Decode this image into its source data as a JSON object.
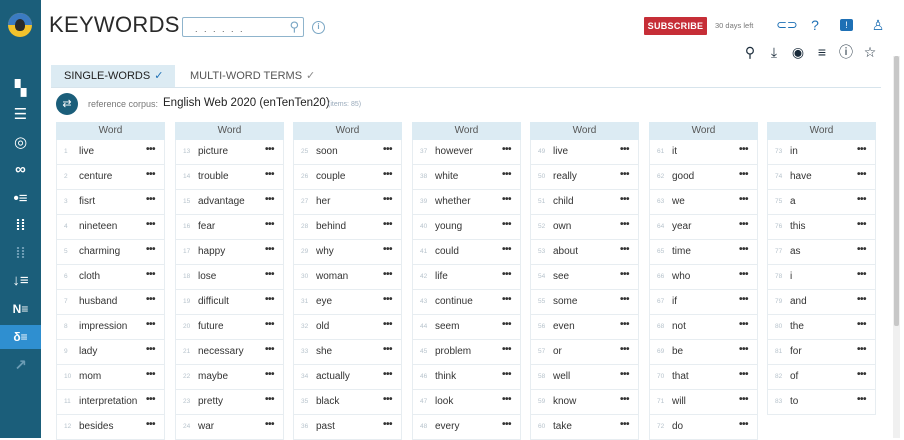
{
  "app": {
    "title": "KEYWORDS"
  },
  "search": {
    "placeholder": ""
  },
  "header": {
    "subscribe_label": "SUBSCRIBE",
    "days_left": "30 days left",
    "brand_color": "#1b5e7a",
    "accent_color": "#1e70b5",
    "subscribe_color": "#c62e37"
  },
  "sidebar": {
    "icons": [
      "logo-icon",
      "dashboard-icon",
      "list-icon",
      "target-icon",
      "infinity-icon",
      "bullet-list-icon",
      "grid-icon",
      "dotted-grid-icon",
      "sort-icon",
      "ne-icon",
      "delta-list-icon",
      "trend-icon"
    ]
  },
  "tabs": [
    {
      "label": "SINGLE-WORDS",
      "check": "✓",
      "active": true
    },
    {
      "label": "MULTI-WORD TERMS",
      "check": "✓",
      "active": false
    }
  ],
  "corpus": {
    "label": "reference corpus:",
    "value": "English Web 2020 (enTenTen20)",
    "items": "(items: 85)"
  },
  "table": {
    "column_header": "Word",
    "more_label": "•••",
    "columns": [
      [
        {
          "n": "1",
          "w": "live"
        },
        {
          "n": "2",
          "w": "centure"
        },
        {
          "n": "3",
          "w": "fisrt"
        },
        {
          "n": "4",
          "w": "nineteen"
        },
        {
          "n": "5",
          "w": "charming"
        },
        {
          "n": "6",
          "w": "cloth"
        },
        {
          "n": "7",
          "w": "husband"
        },
        {
          "n": "8",
          "w": "impression"
        },
        {
          "n": "9",
          "w": "lady"
        },
        {
          "n": "10",
          "w": "mom"
        },
        {
          "n": "11",
          "w": "interpretation"
        },
        {
          "n": "12",
          "w": "besides"
        }
      ],
      [
        {
          "n": "13",
          "w": "picture"
        },
        {
          "n": "14",
          "w": "trouble"
        },
        {
          "n": "15",
          "w": "advantage"
        },
        {
          "n": "16",
          "w": "fear"
        },
        {
          "n": "17",
          "w": "happy"
        },
        {
          "n": "18",
          "w": "lose"
        },
        {
          "n": "19",
          "w": "difficult"
        },
        {
          "n": "20",
          "w": "future"
        },
        {
          "n": "21",
          "w": "necessary"
        },
        {
          "n": "22",
          "w": "maybe"
        },
        {
          "n": "23",
          "w": "pretty"
        },
        {
          "n": "24",
          "w": "war"
        }
      ],
      [
        {
          "n": "25",
          "w": "soon"
        },
        {
          "n": "26",
          "w": "couple"
        },
        {
          "n": "27",
          "w": "her"
        },
        {
          "n": "28",
          "w": "behind"
        },
        {
          "n": "29",
          "w": "why"
        },
        {
          "n": "30",
          "w": "woman"
        },
        {
          "n": "31",
          "w": "eye"
        },
        {
          "n": "32",
          "w": "old"
        },
        {
          "n": "33",
          "w": "she"
        },
        {
          "n": "34",
          "w": "actually"
        },
        {
          "n": "35",
          "w": "black"
        },
        {
          "n": "36",
          "w": "past"
        }
      ],
      [
        {
          "n": "37",
          "w": "however"
        },
        {
          "n": "38",
          "w": "white"
        },
        {
          "n": "39",
          "w": "whether"
        },
        {
          "n": "40",
          "w": "young"
        },
        {
          "n": "41",
          "w": "could"
        },
        {
          "n": "42",
          "w": "life"
        },
        {
          "n": "43",
          "w": "continue"
        },
        {
          "n": "44",
          "w": "seem"
        },
        {
          "n": "45",
          "w": "problem"
        },
        {
          "n": "46",
          "w": "think"
        },
        {
          "n": "47",
          "w": "look"
        },
        {
          "n": "48",
          "w": "every"
        }
      ],
      [
        {
          "n": "49",
          "w": "live"
        },
        {
          "n": "50",
          "w": "really"
        },
        {
          "n": "51",
          "w": "child"
        },
        {
          "n": "52",
          "w": "own"
        },
        {
          "n": "53",
          "w": "about"
        },
        {
          "n": "54",
          "w": "see"
        },
        {
          "n": "55",
          "w": "some"
        },
        {
          "n": "56",
          "w": "even"
        },
        {
          "n": "57",
          "w": "or"
        },
        {
          "n": "58",
          "w": "well"
        },
        {
          "n": "59",
          "w": "know"
        },
        {
          "n": "60",
          "w": "take"
        }
      ],
      [
        {
          "n": "61",
          "w": "it"
        },
        {
          "n": "62",
          "w": "good"
        },
        {
          "n": "63",
          "w": "we"
        },
        {
          "n": "64",
          "w": "year"
        },
        {
          "n": "65",
          "w": "time"
        },
        {
          "n": "66",
          "w": "who"
        },
        {
          "n": "67",
          "w": "if"
        },
        {
          "n": "68",
          "w": "not"
        },
        {
          "n": "69",
          "w": "be"
        },
        {
          "n": "70",
          "w": "that"
        },
        {
          "n": "71",
          "w": "will"
        },
        {
          "n": "72",
          "w": "do"
        }
      ],
      [
        {
          "n": "73",
          "w": "in"
        },
        {
          "n": "74",
          "w": "have"
        },
        {
          "n": "75",
          "w": "a"
        },
        {
          "n": "76",
          "w": "this"
        },
        {
          "n": "77",
          "w": "as"
        },
        {
          "n": "78",
          "w": "i"
        },
        {
          "n": "79",
          "w": "and"
        },
        {
          "n": "80",
          "w": "the"
        },
        {
          "n": "81",
          "w": "for"
        },
        {
          "n": "82",
          "w": "of"
        },
        {
          "n": "83",
          "w": "to"
        }
      ]
    ]
  }
}
